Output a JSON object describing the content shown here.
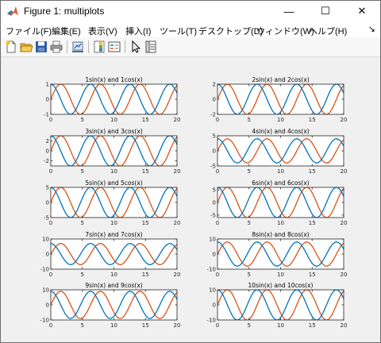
{
  "window": {
    "title": "Figure 1: multiplots",
    "minimize_glyph": "—",
    "maximize_glyph": "☐",
    "close_glyph": "✕"
  },
  "menu": {
    "items": [
      {
        "label": "ファイル(F)"
      },
      {
        "label": "編集(E)"
      },
      {
        "label": "表示(V)"
      },
      {
        "label": "挿入(I)"
      },
      {
        "label": "ツール(T)"
      },
      {
        "label": "デスクトップ(D)"
      },
      {
        "label": "ウィンドウ(W)"
      },
      {
        "label": "ヘルプ(H)"
      }
    ],
    "overflow_glyph": "↘"
  },
  "toolbar": {
    "buttons": [
      {
        "icon": "new-figure-icon"
      },
      {
        "icon": "open-file-icon"
      },
      {
        "icon": "save-icon"
      },
      {
        "icon": "print-icon"
      },
      {
        "icon": "link-plot-icon"
      },
      {
        "icon": "insert-colorbar-icon"
      },
      {
        "icon": "insert-legend-icon"
      },
      {
        "icon": "edit-plot-arrow-icon"
      },
      {
        "icon": "property-inspector-icon"
      }
    ]
  },
  "colors": {
    "sin": "#d95319",
    "cos": "#0072bd"
  },
  "chart_data": [
    {
      "type": "line",
      "title": "1sin(x) and 1cos(x)",
      "xlim": [
        0,
        20
      ],
      "ylim": [
        -1,
        1
      ],
      "xticks": [
        0,
        5,
        10,
        15,
        20
      ],
      "yticks": [
        -1,
        0,
        1
      ],
      "series": [
        {
          "expr": "1*sin(x)",
          "amplitude": 1,
          "func": "sin"
        },
        {
          "expr": "1*cos(x)",
          "amplitude": 1,
          "func": "cos"
        }
      ]
    },
    {
      "type": "line",
      "title": "2sin(x) and 2cos(x)",
      "xlim": [
        0,
        20
      ],
      "ylim": [
        -2,
        2
      ],
      "xticks": [
        0,
        5,
        10,
        15,
        20
      ],
      "yticks": [
        -2,
        0,
        2
      ],
      "series": [
        {
          "expr": "2*sin(x)",
          "amplitude": 2,
          "func": "sin"
        },
        {
          "expr": "2*cos(x)",
          "amplitude": 2,
          "func": "cos"
        }
      ]
    },
    {
      "type": "line",
      "title": "3sin(x) and 3cos(x)",
      "xlim": [
        0,
        20
      ],
      "ylim": [
        -3,
        3
      ],
      "xticks": [
        0,
        5,
        10,
        15,
        20
      ],
      "yticks": [
        -2,
        0,
        2
      ],
      "series": [
        {
          "expr": "3*sin(x)",
          "amplitude": 3,
          "func": "sin"
        },
        {
          "expr": "3*cos(x)",
          "amplitude": 3,
          "func": "cos"
        }
      ]
    },
    {
      "type": "line",
      "title": "4sin(x) and 4cos(x)",
      "xlim": [
        0,
        20
      ],
      "ylim": [
        -5,
        5
      ],
      "xticks": [
        0,
        5,
        10,
        15,
        20
      ],
      "yticks": [
        -5,
        0,
        5
      ],
      "series": [
        {
          "expr": "4*sin(x)",
          "amplitude": 4,
          "func": "sin"
        },
        {
          "expr": "4*cos(x)",
          "amplitude": 4,
          "func": "cos"
        }
      ]
    },
    {
      "type": "line",
      "title": "5sin(x) and 5cos(x)",
      "xlim": [
        0,
        20
      ],
      "ylim": [
        -5,
        5
      ],
      "xticks": [
        0,
        5,
        10,
        15,
        20
      ],
      "yticks": [
        -5,
        0,
        5
      ],
      "series": [
        {
          "expr": "5*sin(x)",
          "amplitude": 5,
          "func": "sin"
        },
        {
          "expr": "5*cos(x)",
          "amplitude": 5,
          "func": "cos"
        }
      ]
    },
    {
      "type": "line",
      "title": "6sin(x) and 6cos(x)",
      "xlim": [
        0,
        20
      ],
      "ylim": [
        -6,
        6
      ],
      "xticks": [
        0,
        5,
        10,
        15,
        20
      ],
      "yticks": [
        -5,
        0,
        5
      ],
      "series": [
        {
          "expr": "6*sin(x)",
          "amplitude": 6,
          "func": "sin"
        },
        {
          "expr": "6*cos(x)",
          "amplitude": 6,
          "func": "cos"
        }
      ]
    },
    {
      "type": "line",
      "title": "7sin(x) and 7cos(x)",
      "xlim": [
        0,
        20
      ],
      "ylim": [
        -10,
        10
      ],
      "xticks": [
        0,
        5,
        10,
        15,
        20
      ],
      "yticks": [
        -10,
        0,
        10
      ],
      "series": [
        {
          "expr": "7*sin(x)",
          "amplitude": 7,
          "func": "sin"
        },
        {
          "expr": "7*cos(x)",
          "amplitude": 7,
          "func": "cos"
        }
      ]
    },
    {
      "type": "line",
      "title": "8sin(x) and 8cos(x)",
      "xlim": [
        0,
        20
      ],
      "ylim": [
        -10,
        10
      ],
      "xticks": [
        0,
        5,
        10,
        15,
        20
      ],
      "yticks": [
        -10,
        0,
        10
      ],
      "series": [
        {
          "expr": "8*sin(x)",
          "amplitude": 8,
          "func": "sin"
        },
        {
          "expr": "8*cos(x)",
          "amplitude": 8,
          "func": "cos"
        }
      ]
    },
    {
      "type": "line",
      "title": "9sin(x) and 9cos(x)",
      "xlim": [
        0,
        20
      ],
      "ylim": [
        -10,
        10
      ],
      "xticks": [
        0,
        5,
        10,
        15,
        20
      ],
      "yticks": [
        -10,
        0,
        10
      ],
      "series": [
        {
          "expr": "9*sin(x)",
          "amplitude": 9,
          "func": "sin"
        },
        {
          "expr": "9*cos(x)",
          "amplitude": 9,
          "func": "cos"
        }
      ]
    },
    {
      "type": "line",
      "title": "10sin(x) and 10cos(x)",
      "xlim": [
        0,
        20
      ],
      "ylim": [
        -10,
        10
      ],
      "xticks": [
        0,
        5,
        10,
        15,
        20
      ],
      "yticks": [
        -10,
        0,
        10
      ],
      "series": [
        {
          "expr": "10*sin(x)",
          "amplitude": 10,
          "func": "sin"
        },
        {
          "expr": "10*cos(x)",
          "amplitude": 10,
          "func": "cos"
        }
      ]
    }
  ]
}
